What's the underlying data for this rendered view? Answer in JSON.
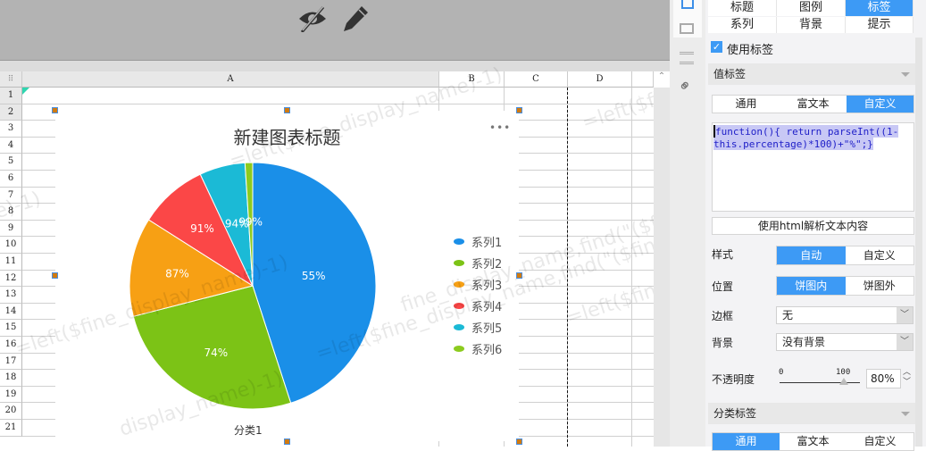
{
  "toolbar": {
    "icons": [
      "eye-slash-icon",
      "pencil-icon"
    ]
  },
  "sheet": {
    "columns": [
      "A",
      "B",
      "C",
      "D"
    ],
    "rows": [
      "1",
      "2",
      "3",
      "4",
      "5",
      "6",
      "7",
      "8",
      "9",
      "10",
      "11",
      "12",
      "13",
      "14",
      "15",
      "16",
      "17",
      "18",
      "19",
      "20",
      "21"
    ],
    "watermark": [
      "=left($fine_display_name)-1)",
      "=left($fine_display_name,find(\"($fine_display_name)-1)",
      "display_name)-1)",
      "ne)-1)",
      "=left($fin",
      "fine_display_name,find(\"($fine_disp"
    ]
  },
  "chart_data": {
    "type": "pie",
    "title": "新建图表标题",
    "category": "分类1",
    "more_menu": "•••",
    "series": [
      {
        "name": "系列1",
        "percent": 45,
        "label": "55%",
        "color": "#1a8fe8"
      },
      {
        "name": "系列2",
        "percent": 26,
        "label": "74%",
        "color": "#7cc316"
      },
      {
        "name": "系列3",
        "percent": 13,
        "label": "87%",
        "color": "#f7a014"
      },
      {
        "name": "系列4",
        "percent": 9,
        "label": "91%",
        "color": "#fb4747"
      },
      {
        "name": "系列5",
        "percent": 6,
        "label": "94%",
        "color": "#1bbad6"
      },
      {
        "name": "系列6",
        "percent": 1,
        "label": "99%",
        "color": "#8ccb1f"
      }
    ],
    "legend_position": "right"
  },
  "panel": {
    "tabs": [
      "标题",
      "图例",
      "标签",
      "系列",
      "背景",
      "提示"
    ],
    "active_tab": "标签",
    "use_label": "使用标签",
    "value_label_section": "值标签",
    "value_subtabs": [
      "通用",
      "富文本",
      "自定义"
    ],
    "code_line1": "function(){ return parseInt((1-",
    "code_line2": "this.percentage)*100)+\"%\";}",
    "html_parse_button": "使用html解析文本内容",
    "style_label": "样式",
    "style_options": [
      "自动",
      "自定义"
    ],
    "position_label": "位置",
    "position_options": [
      "饼图内",
      "饼图外"
    ],
    "border_label": "边框",
    "border_value": "无",
    "background_label": "背景",
    "background_value": "没有背景",
    "opacity_label": "不透明度",
    "slider_min": "0",
    "slider_max": "100",
    "opacity_value": "80%",
    "opacity": 0.8,
    "category_label_section": "分类标签",
    "category_subtabs": [
      "通用",
      "富文本",
      "自定义"
    ]
  }
}
